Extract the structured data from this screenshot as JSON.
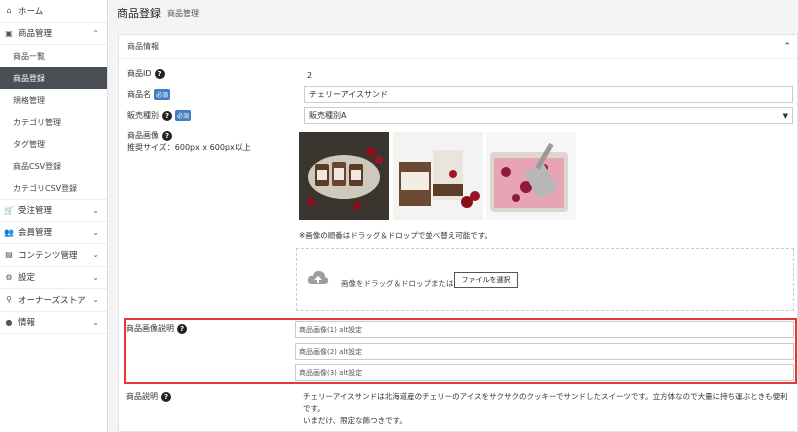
{
  "sidebar": {
    "home": "ホーム",
    "product_mgmt": "商品管理",
    "sub_items": [
      "商品一覧",
      "商品登録",
      "規格管理",
      "カテゴリ管理",
      "タグ管理",
      "商品CSV登録",
      "カテゴリCSV登録"
    ],
    "order_mgmt": "受注管理",
    "member_mgmt": "会員管理",
    "content_mgmt": "コンテンツ管理",
    "settings": "設定",
    "owners_store": "オーナーズストア",
    "info": "情報"
  },
  "header": {
    "title": "商品登録",
    "crumb": "商品管理"
  },
  "card": {
    "title": "商品情報",
    "fields": {
      "id_label": "商品ID",
      "id_value": "2",
      "name_label": "商品名",
      "name_value": "チェリーアイスサンド",
      "type_label": "販売種別",
      "type_value": "販売種別A",
      "required": "必須",
      "image_label": "商品画像",
      "image_size": "推奨サイズ：600px x 600px以上",
      "drag_hint": "※画像の順番はドラッグ＆ドロップで並べ替え可能です。",
      "drop_text": "画像をドラッグ＆ドロップまたは",
      "file_button": "ファイルを選択",
      "alt_label": "商品画像説明",
      "alt_values": [
        "商品画像(1) alt設定",
        "商品画像(2) alt設定",
        "商品画像(3) alt設定"
      ],
      "desc_label": "商品説明",
      "desc_line1": "チェリーアイスサンドは北海道産のチェリーのアイスをサクサクのクッキーでサンドしたスイーツです。立方体なので大量に持ち運ぶときも便利です。",
      "desc_line2": "いまだけ、限定な飾つきです。"
    }
  },
  "colors": {
    "active_bg": "#4a4f55",
    "required_badge": "#437ec4",
    "highlight": "#e53935"
  }
}
